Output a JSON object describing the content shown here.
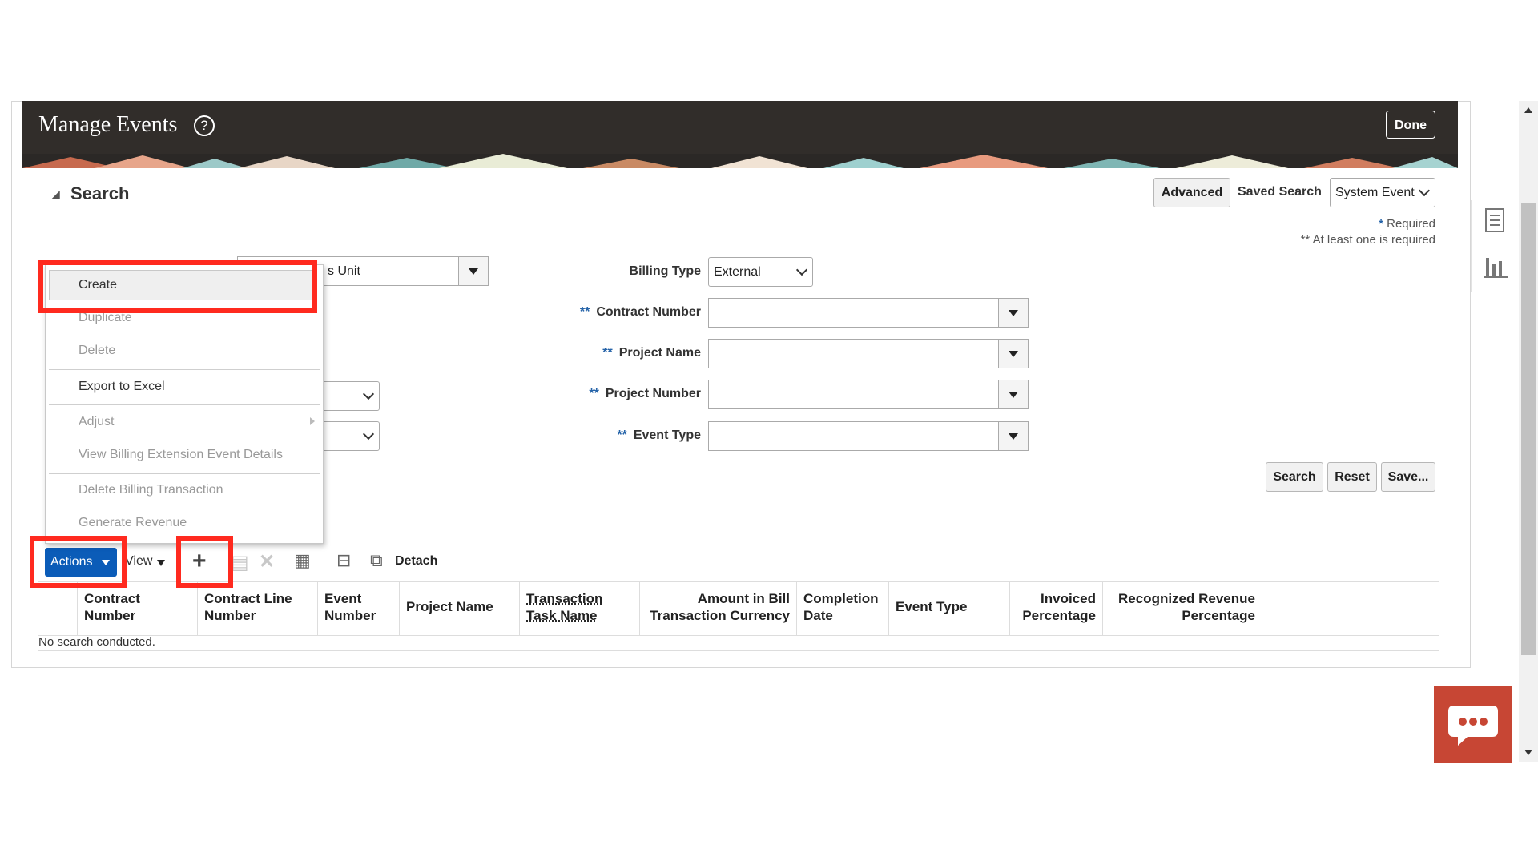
{
  "header": {
    "title": "Manage Events",
    "done_label": "Done"
  },
  "search": {
    "heading": "Search",
    "advanced_label": "Advanced",
    "saved_search_label": "Saved Search",
    "saved_search_value": "System Event",
    "required_star": "*",
    "required_text": "Required",
    "at_least_one_text": "** At least one is required"
  },
  "form": {
    "business_unit_partial": "s Unit",
    "billing_type_label": "Billing Type",
    "billing_type_value": "External",
    "stars": "**",
    "contract_number_label": "Contract Number",
    "project_name_label": "Project Name",
    "project_number_label": "Project Number",
    "event_type_label": "Event Type"
  },
  "buttons": {
    "search": "Search",
    "reset": "Reset",
    "save": "Save..."
  },
  "toolbar": {
    "actions_label": "Actions",
    "view_label": "View",
    "detach_label": "Detach"
  },
  "menu": {
    "create": "Create",
    "duplicate": "Duplicate",
    "delete": "Delete",
    "export": "Export to Excel",
    "adjust": "Adjust",
    "view_billing_ext": "View Billing Extension Event Details",
    "delete_billing_txn": "Delete Billing Transaction",
    "generate_revenue": "Generate Revenue"
  },
  "table": {
    "columns": [
      [
        "Contract",
        "Number"
      ],
      [
        "Contract Line",
        "Number"
      ],
      [
        "Event",
        "Number"
      ],
      [
        "Project Name",
        ""
      ],
      [
        "Transaction",
        "Task Name"
      ],
      [
        "Amount in Bill",
        "Transaction Currency"
      ],
      [
        "Completion",
        "Date"
      ],
      [
        "Event Type",
        ""
      ],
      [
        "Invoiced",
        "Percentage"
      ],
      [
        "Recognized Revenue",
        "Percentage"
      ]
    ],
    "empty_message": "No search conducted."
  },
  "colors": {
    "header_bg": "#312d2a",
    "actions_blue": "#0b5cb8",
    "highlight_red": "#ff2a1f",
    "chat_red": "#c74634"
  }
}
